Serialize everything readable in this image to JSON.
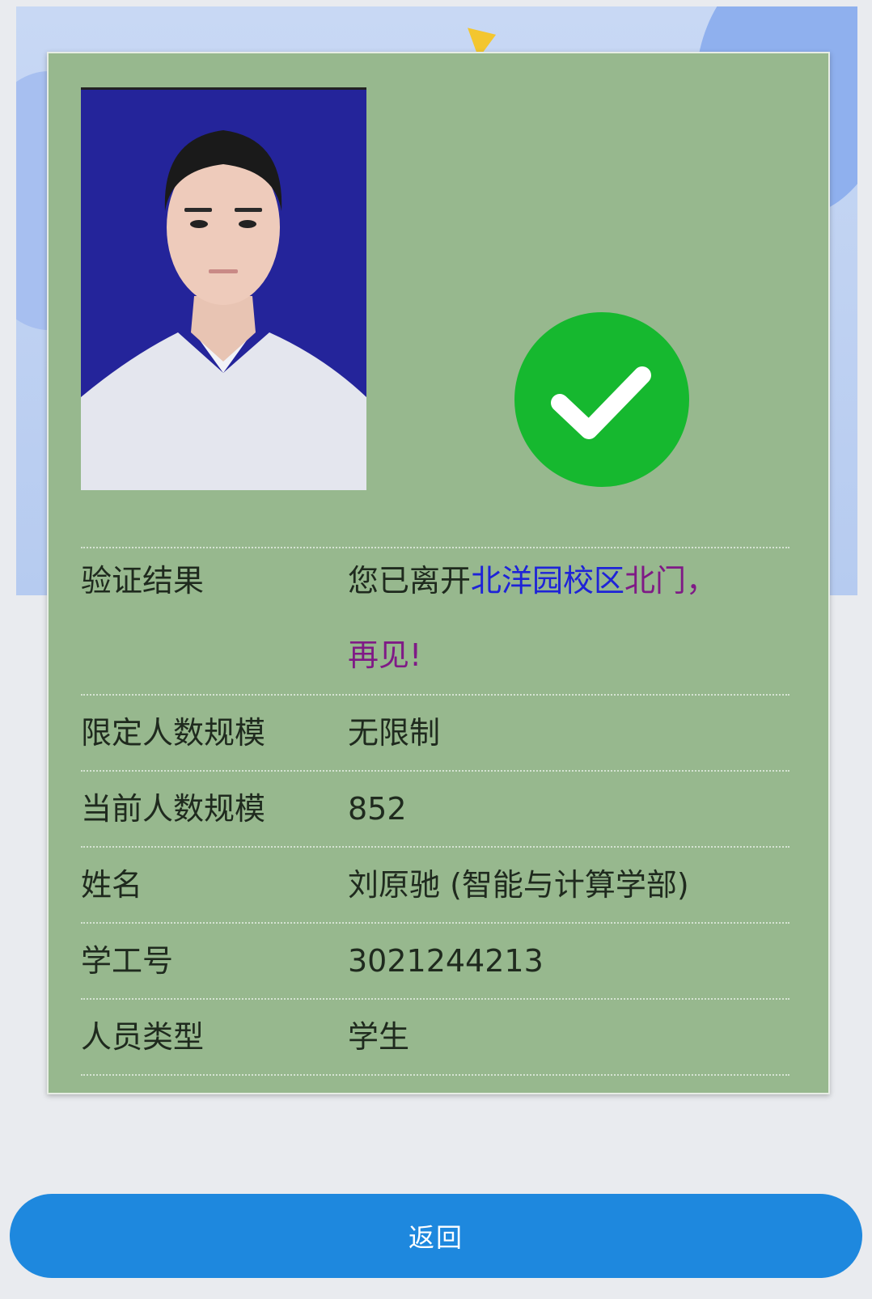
{
  "result": {
    "label": "验证结果",
    "value_part1": "您已离开",
    "campus": "北洋园校区",
    "gate": "北门",
    "comma": "，",
    "farewell": "再见!"
  },
  "rows": [
    {
      "label": "限定人数规模",
      "value": "无限制"
    },
    {
      "label": "当前人数规模",
      "value": "852"
    },
    {
      "label": "姓名",
      "value": "刘原驰 (智能与计算学部)"
    },
    {
      "label": "学工号",
      "value": "3021244213"
    },
    {
      "label": "人员类型",
      "value": "学生"
    }
  ],
  "back_button": "返回",
  "colors": {
    "card": "#97b88e",
    "check": "#16b82f",
    "button": "#1e88de",
    "campus_text": "#1e23d8",
    "gate_text": "#7f1a86"
  },
  "icons": {
    "check": "check-circle-icon"
  }
}
